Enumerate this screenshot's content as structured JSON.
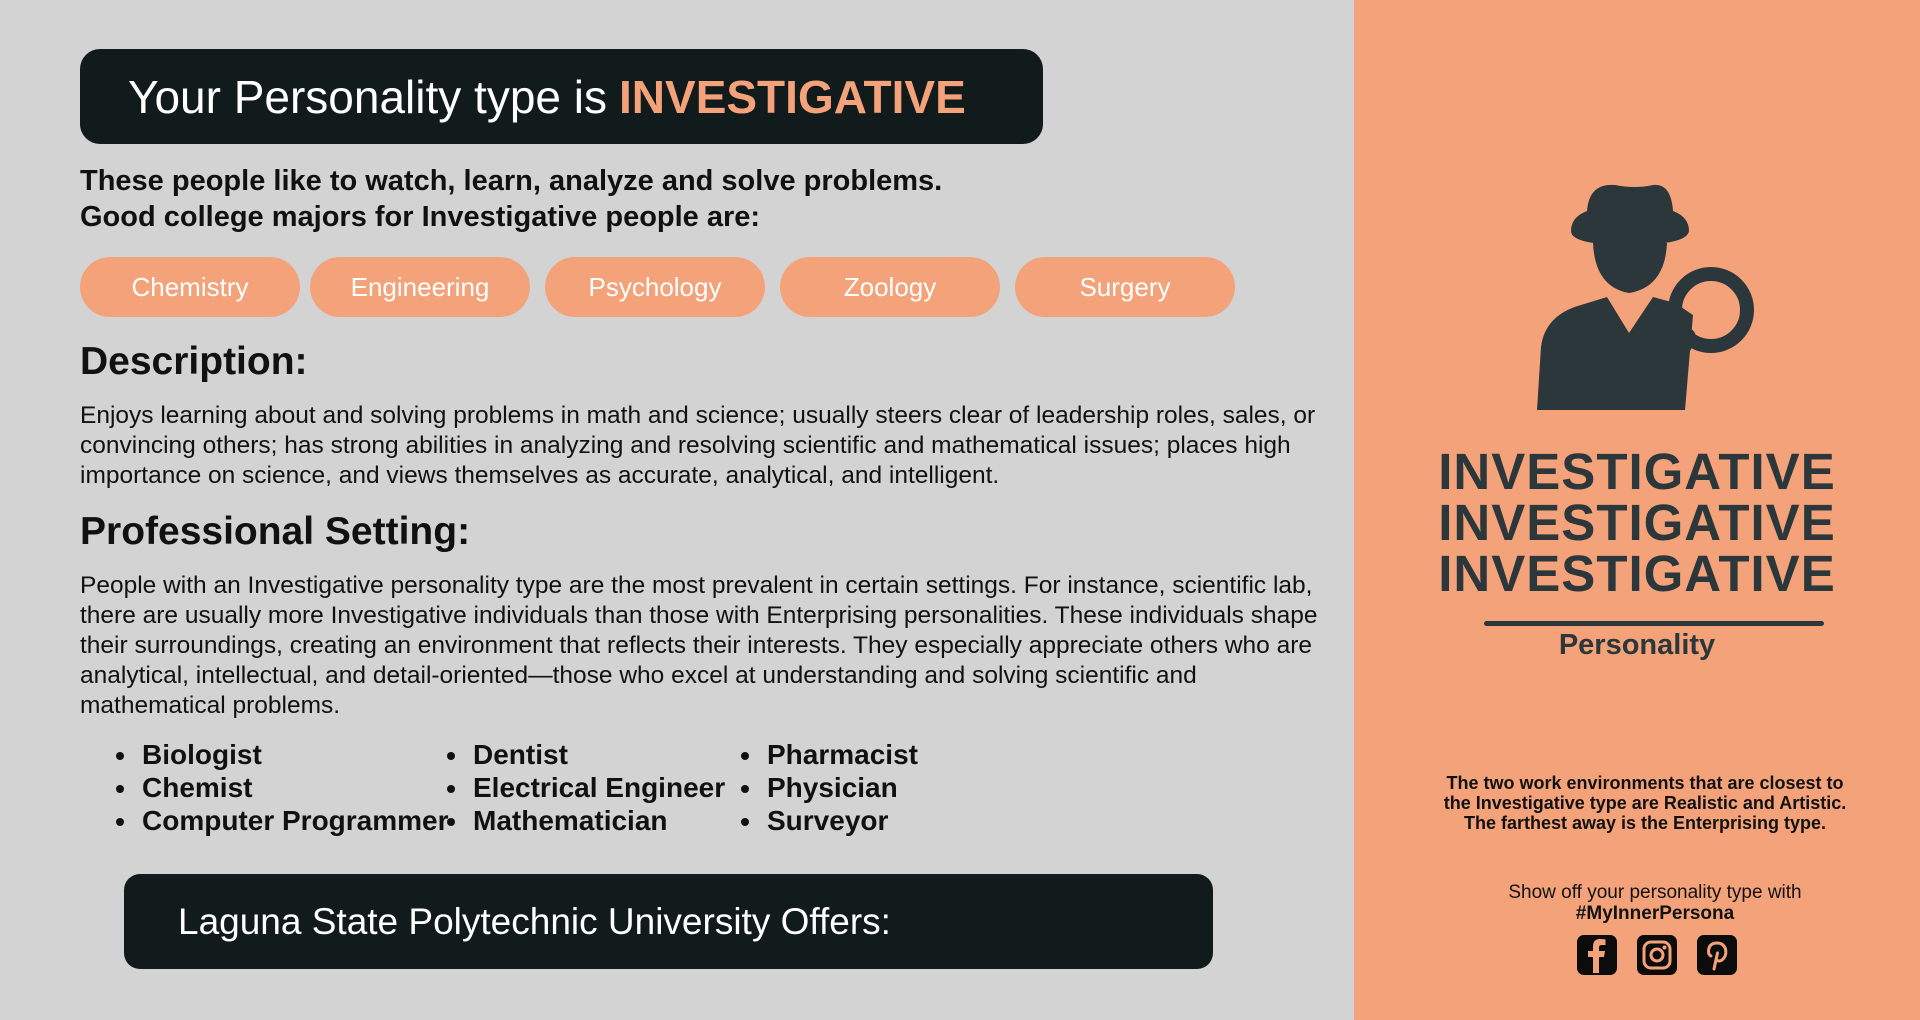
{
  "header": {
    "title_prefix": "Your Personality type is",
    "title_highlight": "INVESTIGATIVE"
  },
  "intro": {
    "line1": "These people like to watch, learn, analyze and solve problems.",
    "line2": "Good college majors for Investigative people are:"
  },
  "majors": [
    "Chemistry",
    "Engineering",
    "Psychology",
    "Zoology",
    "Surgery"
  ],
  "description": {
    "heading": "Description:",
    "text": "Enjoys learning about and solving problems in math and science; usually steers clear of leadership roles, sales, or convincing others; has strong abilities in analyzing and resolving scientific and mathematical issues; places high importance on science, and views themselves as accurate, analytical, and intelligent."
  },
  "professional": {
    "heading": "Professional Setting:",
    "text": "People with an Investigative personality type are the most prevalent in certain settings. For instance, scientific lab, there are usually more Investigative individuals than those with Enterprising personalities. These individuals shape their surroundings, creating an environment that reflects their interests. They especially appreciate others who are analytical, intellectual, and detail-oriented—those who excel at understanding and solving scientific and mathematical problems."
  },
  "careers": [
    [
      "Biologist",
      "Chemist",
      "Computer Programmer"
    ],
    [
      "Dentist",
      "Electrical Engineer",
      "Mathematician"
    ],
    [
      "Pharmacist",
      "Physician",
      "Surveyor"
    ]
  ],
  "offers": {
    "label": "Laguna State Polytechnic University Offers:"
  },
  "sidebar": {
    "big_word": "INVESTIGATIVE",
    "subtitle": "Personality",
    "note_line1": "The two work environments that are closest to",
    "note_line2": "the Investigative type are Realistic and Artistic.",
    "note_line3": "The farthest away is the Enterprising type.",
    "share_text": "Show off your personality type with",
    "hashtag": "#MyInnerPersona",
    "socials": [
      "facebook-icon",
      "instagram-icon",
      "pinterest-icon"
    ]
  },
  "colors": {
    "accent": "#f4a27a",
    "dark": "#121b1b",
    "background": "#d3d3d3",
    "emblem": "#2b373a"
  }
}
